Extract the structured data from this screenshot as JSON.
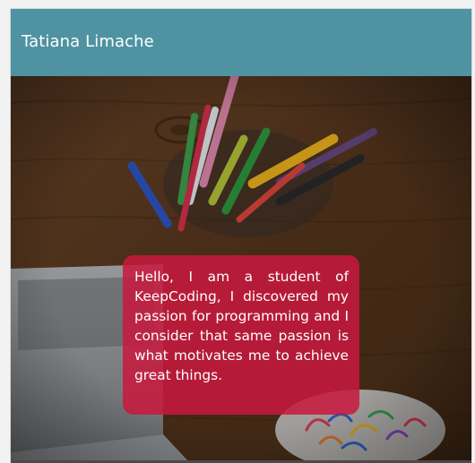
{
  "header": {
    "title": "Tatiana Limache"
  },
  "intro": {
    "text": "Hello, I am a student of KeepCoding, I discovered my passion for programming and I consider that same passion is what motivates me to achieve great things."
  },
  "colors": {
    "header_bg": "#4f93a3",
    "card_bg": "#c8183e",
    "text": "#ffffff"
  },
  "hero_image": {
    "icon": "desk-pencils-laptop-photo"
  }
}
